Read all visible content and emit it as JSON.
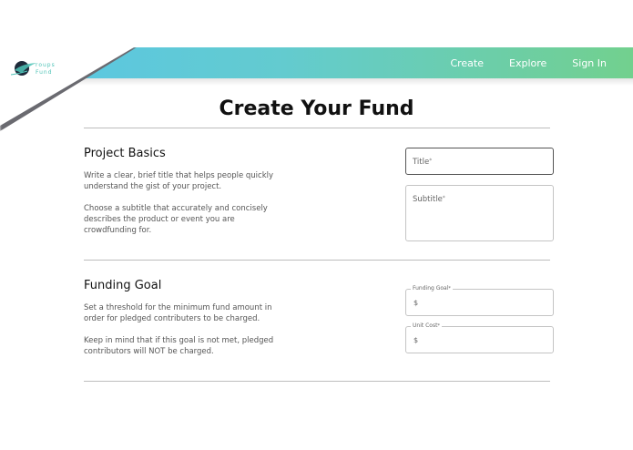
{
  "brand": {
    "logo_text_1": "roups",
    "logo_text_2": "Fund"
  },
  "nav": {
    "items": [
      "Create",
      "Explore",
      "Sign In"
    ]
  },
  "page": {
    "title": "Create Your Fund"
  },
  "sections": {
    "basics": {
      "heading": "Project Basics",
      "desc_1": "Write a clear, brief title that helps people quickly understand the gist of your project.",
      "desc_2": "Choose a subtitle that accurately and concisely describes the product or event you are crowdfunding for.",
      "title_label": "Title",
      "subtitle_label": "Subtitle",
      "required_mark": "*"
    },
    "funding": {
      "heading": "Funding Goal",
      "desc_1": "Set a threshold for the minimum fund amount in order for pledged contributers to be charged.",
      "desc_2": "Keep in mind that if this goal is not met, pledged contributors will NOT be charged.",
      "goal_label": "Funding Goal",
      "unit_label": "Unit Cost",
      "currency_prefix": "$",
      "required_mark": "*"
    }
  },
  "colors": {
    "gradient_start": "#59c6e6",
    "gradient_end": "#72d08e",
    "logo": "#4fc3b7"
  }
}
